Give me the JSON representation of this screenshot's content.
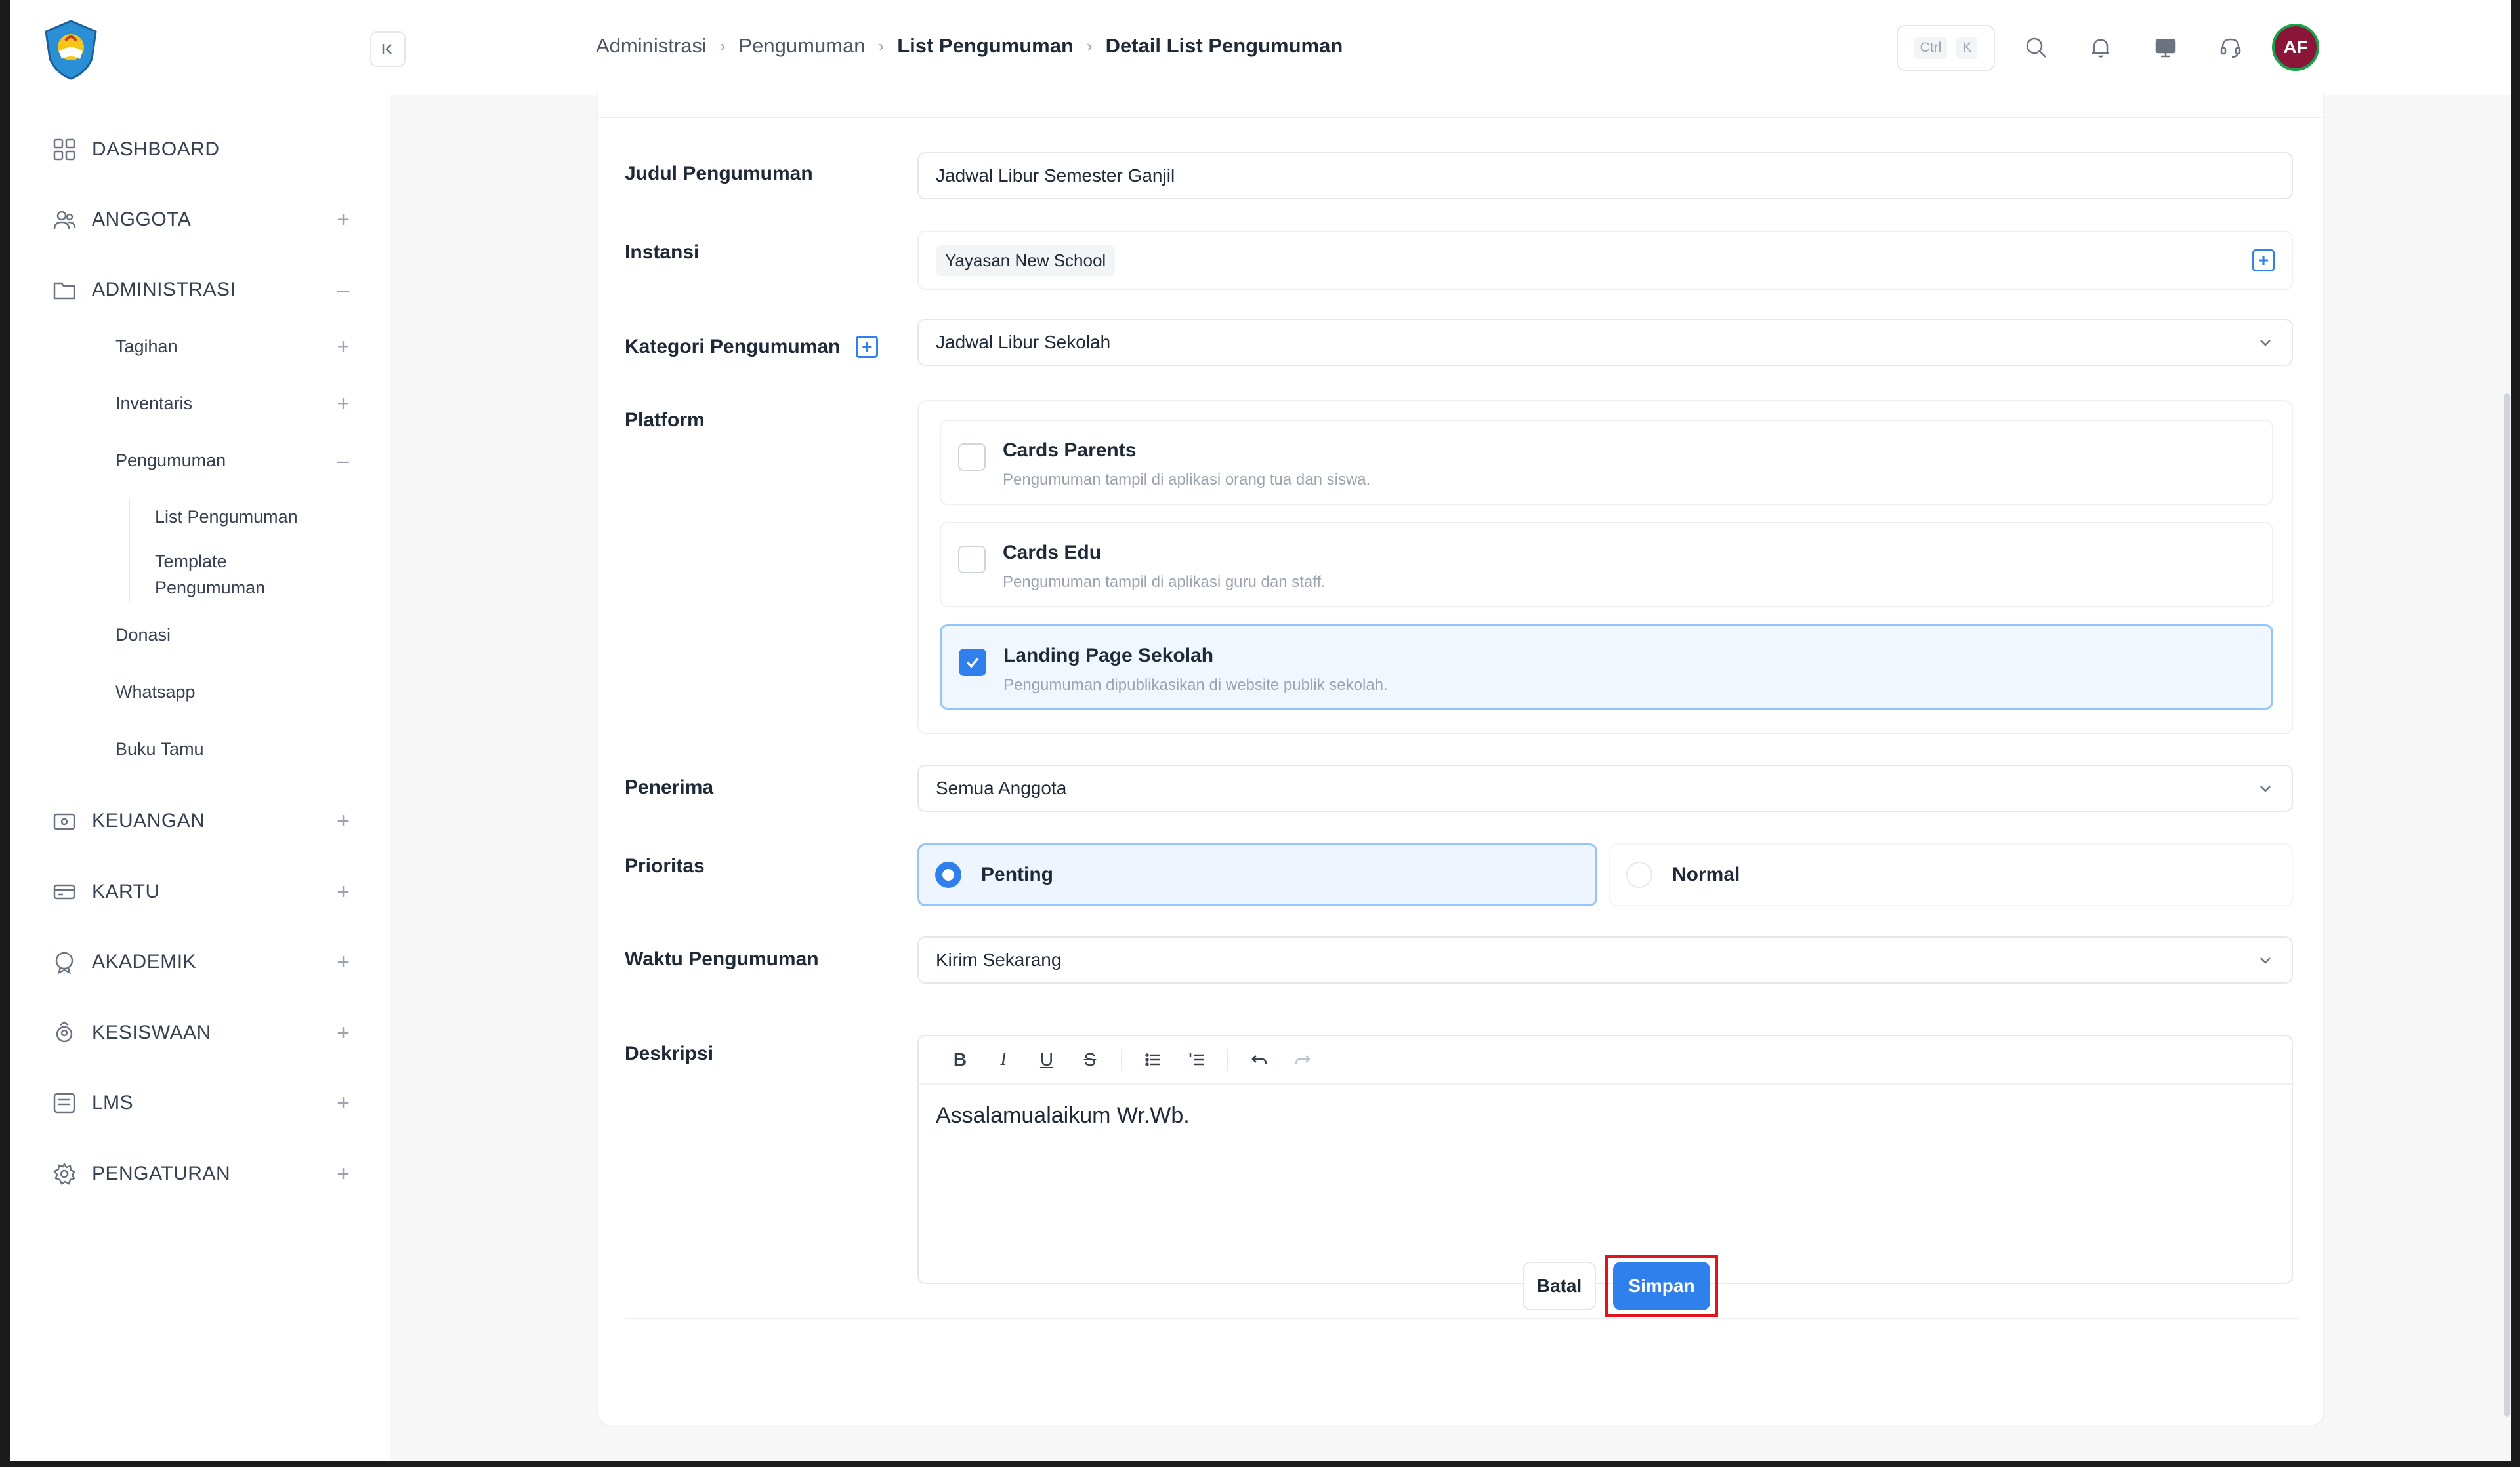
{
  "sidebar": {
    "items": [
      {
        "label": "DASHBOARD",
        "toggle": ""
      },
      {
        "label": "ANGGOTA",
        "toggle": "+"
      },
      {
        "label": "ADMINISTRASI",
        "toggle": "–"
      },
      {
        "label": "KEUANGAN",
        "toggle": "+"
      },
      {
        "label": "KARTU",
        "toggle": "+"
      },
      {
        "label": "AKADEMIK",
        "toggle": "+"
      },
      {
        "label": "KESISWAAN",
        "toggle": "+"
      },
      {
        "label": "LMS",
        "toggle": "+"
      },
      {
        "label": "PENGATURAN",
        "toggle": "+"
      }
    ],
    "admin_sub": [
      {
        "label": "Tagihan",
        "toggle": "+"
      },
      {
        "label": "Inventaris",
        "toggle": "+"
      },
      {
        "label": "Pengumuman",
        "toggle": "–"
      },
      {
        "label": "Donasi",
        "toggle": ""
      },
      {
        "label": "Whatsapp",
        "toggle": ""
      },
      {
        "label": "Buku Tamu",
        "toggle": ""
      }
    ],
    "pengumuman_sub": [
      {
        "label": "List Pengumuman"
      },
      {
        "label": "Template Pengumuman"
      }
    ]
  },
  "header": {
    "breadcrumb": [
      "Administrasi",
      "Pengumuman",
      "List Pengumuman",
      "Detail List Pengumuman"
    ],
    "shortcut_keys": [
      "Ctrl",
      "K"
    ],
    "avatar_initials": "AF"
  },
  "form": {
    "judul": {
      "label": "Judul Pengumuman",
      "value": "Jadwal Libur Semester Ganjil"
    },
    "instansi": {
      "label": "Instansi",
      "value": "Yayasan New School"
    },
    "kategori": {
      "label": "Kategori Pengumuman",
      "value": "Jadwal Libur Sekolah"
    },
    "platform": {
      "label": "Platform",
      "options": [
        {
          "title": "Cards Parents",
          "desc": "Pengumuman tampil di aplikasi orang tua dan siswa.",
          "checked": false
        },
        {
          "title": "Cards Edu",
          "desc": "Pengumuman tampil di aplikasi guru dan staff.",
          "checked": false
        },
        {
          "title": "Landing Page Sekolah",
          "desc": "Pengumuman dipublikasikan di website publik sekolah.",
          "checked": true
        }
      ]
    },
    "penerima": {
      "label": "Penerima",
      "value": "Semua Anggota"
    },
    "prioritas": {
      "label": "Prioritas",
      "options": [
        "Penting",
        "Normal"
      ],
      "selected": "Penting"
    },
    "waktu": {
      "label": "Waktu Pengumuman",
      "value": "Kirim Sekarang"
    },
    "deskripsi": {
      "label": "Deskripsi",
      "content": "Assalamualaikum Wr.Wb."
    }
  },
  "actions": {
    "cancel": "Batal",
    "save": "Simpan"
  },
  "colors": {
    "accent": "#2f80ed",
    "highlight_border": "#e0141e",
    "avatar_bg": "#8a1538"
  }
}
